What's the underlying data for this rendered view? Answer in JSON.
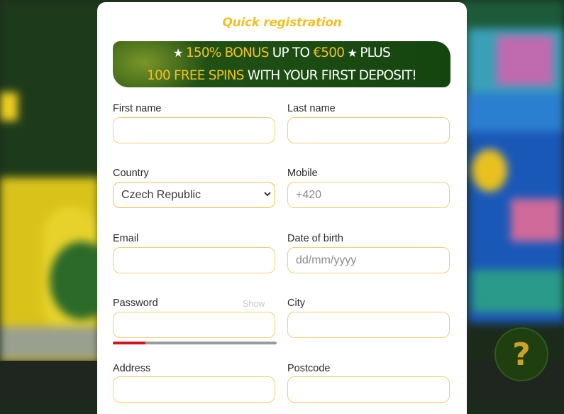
{
  "modal": {
    "title": "Quick registration",
    "banner": {
      "line1": [
        {
          "text": "★ ",
          "tone": "star"
        },
        {
          "text": "150% BONUS",
          "tone": "yellow"
        },
        {
          "text": " UP TO ",
          "tone": "white"
        },
        {
          "text": "€500",
          "tone": "yellow"
        },
        {
          "text": " ★ ",
          "tone": "star"
        },
        {
          "text": "PLUS",
          "tone": "white"
        }
      ],
      "line2": [
        {
          "text": "100 FREE SPINS",
          "tone": "yellow"
        },
        {
          "text": " WITH YOUR FIRST DEPOSIT!",
          "tone": "white"
        }
      ]
    },
    "fields": {
      "first_name": {
        "label": "First name",
        "value": ""
      },
      "last_name": {
        "label": "Last name",
        "value": ""
      },
      "country": {
        "label": "Country",
        "value": "Czech Republic"
      },
      "mobile": {
        "label": "Mobile",
        "placeholder": "+420"
      },
      "email": {
        "label": "Email",
        "value": ""
      },
      "dob": {
        "label": "Date of birth",
        "placeholder": "dd/mm/yyyy"
      },
      "password": {
        "label": "Password",
        "value": "",
        "show_label": "Show",
        "strength": 0.2
      },
      "city": {
        "label": "City",
        "value": ""
      },
      "address": {
        "label": "Address",
        "value": ""
      },
      "postcode": {
        "label": "Postcode",
        "value": ""
      }
    }
  },
  "help_button": {
    "label": "?"
  },
  "colors": {
    "accent_yellow": "#f0c028",
    "banner_green": "#1f5014",
    "input_border": "#f0d070",
    "strength_red": "#d0161c",
    "help_bg": "#1f3f10"
  }
}
